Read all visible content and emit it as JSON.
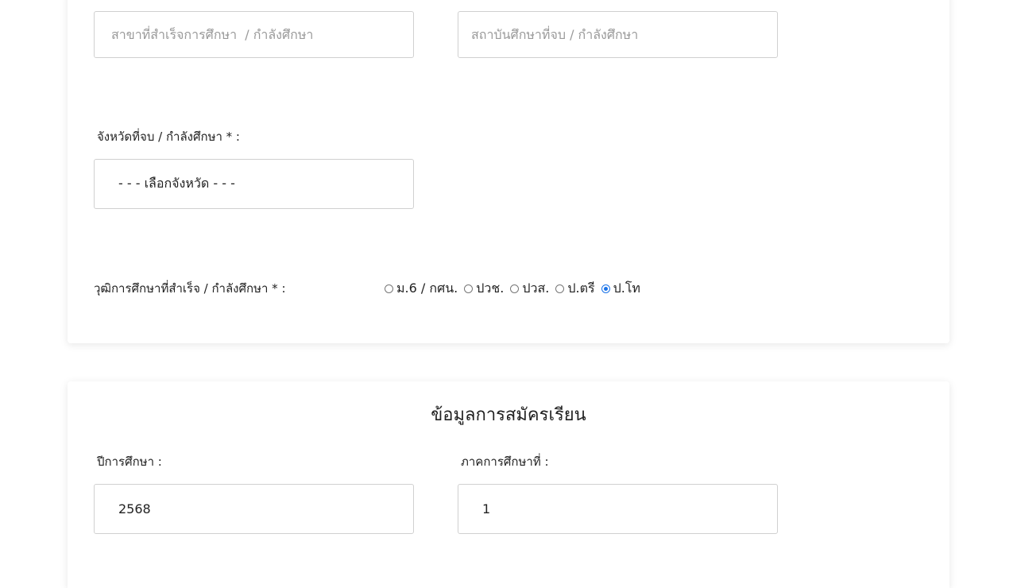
{
  "education": {
    "major_field": {
      "placeholder": "สาขาที่สำเร็จการศึกษา  / กำลังศึกษา",
      "value": ""
    },
    "institution_field": {
      "placeholder": "สถาบันศึกษาที่จบ / กำลังศึกษา",
      "value": ""
    },
    "province_label": "จังหวัดที่จบ / กำลังศึกษา * :",
    "province_select": "- - - เลือกจังหวัด - - -",
    "qualification_label": "วุฒิการศึกษาที่สำเร็จ / กำลังศึกษา * :",
    "qualification_options": [
      {
        "label": "ม.6 / กศน.",
        "checked": false
      },
      {
        "label": "ปวช.",
        "checked": false
      },
      {
        "label": "ปวส.",
        "checked": false
      },
      {
        "label": "ป.ตรี",
        "checked": false
      },
      {
        "label": "ป.โท",
        "checked": true
      }
    ]
  },
  "application": {
    "title": "ข้อมูลการสมัครเรียน",
    "year_label": "ปีการศึกษา :",
    "year_value": "2568",
    "semester_label": "ภาคการศึกษาที่ :",
    "semester_value": "1"
  },
  "colors": {
    "accent": "#1a73e8",
    "border": "#d0d0d0",
    "placeholder": "#9a9a9a"
  }
}
